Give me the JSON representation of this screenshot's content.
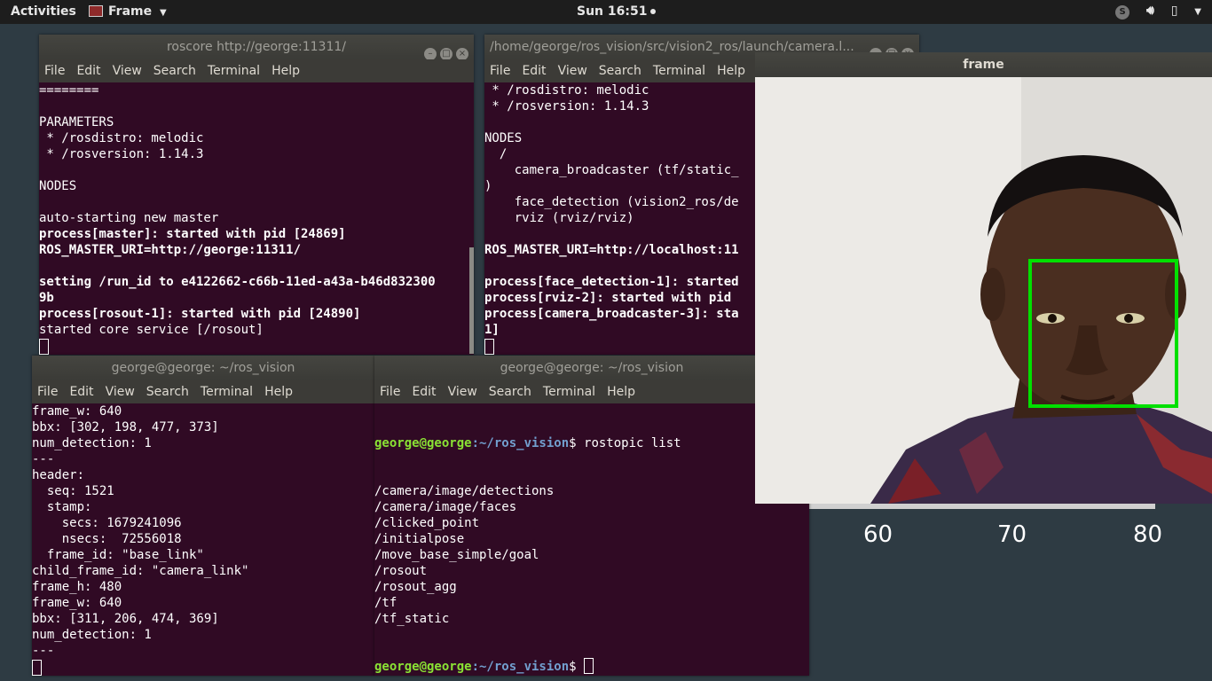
{
  "topbar": {
    "activities": "Activities",
    "app_name": "Frame",
    "clock": "Sun 16:51"
  },
  "desktop": {
    "axis_labels": [
      "60",
      "70",
      "80"
    ]
  },
  "menu": [
    "File",
    "Edit",
    "View",
    "Search",
    "Terminal",
    "Help"
  ],
  "win1": {
    "title": "roscore http://george:11311/",
    "lines": [
      {
        "t": "========",
        "b": false
      },
      {
        "t": "",
        "b": false
      },
      {
        "t": "PARAMETERS",
        "b": false
      },
      {
        "t": " * /rosdistro: melodic",
        "b": false
      },
      {
        "t": " * /rosversion: 1.14.3",
        "b": false
      },
      {
        "t": "",
        "b": false
      },
      {
        "t": "NODES",
        "b": false
      },
      {
        "t": "",
        "b": false
      },
      {
        "t": "auto-starting new master",
        "b": false
      },
      {
        "t": "process[master]: started with pid [24869]",
        "b": true
      },
      {
        "t": "ROS_MASTER_URI=http://george:11311/",
        "b": true
      },
      {
        "t": "",
        "b": false
      },
      {
        "t": "setting /run_id to e4122662-c66b-11ed-a43a-b46d832300",
        "b": true
      },
      {
        "t": "9b",
        "b": true
      },
      {
        "t": "process[rosout-1]: started with pid [24890]",
        "b": true
      },
      {
        "t": "started core service [/rosout]",
        "b": false
      }
    ]
  },
  "win2": {
    "title": "/home/george/ros_vision/src/vision2_ros/launch/camera.l...",
    "lines": [
      {
        "t": " * /rosdistro: melodic",
        "b": false
      },
      {
        "t": " * /rosversion: 1.14.3",
        "b": false
      },
      {
        "t": "",
        "b": false
      },
      {
        "t": "NODES",
        "b": false
      },
      {
        "t": "  /",
        "b": false
      },
      {
        "t": "    camera_broadcaster (tf/static_",
        "b": false
      },
      {
        "t": ")",
        "b": false
      },
      {
        "t": "    face_detection (vision2_ros/de",
        "b": false
      },
      {
        "t": "    rviz (rviz/rviz)",
        "b": false
      },
      {
        "t": "",
        "b": false
      },
      {
        "t": "ROS_MASTER_URI=http://localhost:11",
        "b": true
      },
      {
        "t": "",
        "b": false
      },
      {
        "t": "process[face_detection-1]: started",
        "b": true
      },
      {
        "t": "process[rviz-2]: started with pid",
        "b": true
      },
      {
        "t": "process[camera_broadcaster-3]: sta",
        "b": true
      },
      {
        "t": "1]",
        "b": true
      }
    ]
  },
  "win3": {
    "title": "george@george: ~/ros_vision",
    "lines": [
      "frame_w: 640",
      "bbx: [302, 198, 477, 373]",
      "num_detection: 1",
      "---",
      "header:",
      "  seq: 1521",
      "  stamp:",
      "    secs: 1679241096",
      "    nsecs:  72556018",
      "  frame_id: \"base_link\"",
      "child_frame_id: \"camera_link\"",
      "frame_h: 480",
      "frame_w: 640",
      "bbx: [311, 206, 474, 369]",
      "num_detection: 1",
      "---"
    ]
  },
  "win4": {
    "title": "george@george: ~/ros_vision",
    "prompt_user": "george@george",
    "prompt_path": ":~/ros_vision",
    "prompt_sign": "$ ",
    "command": "rostopic list",
    "topics": [
      "/camera/image/detections",
      "/camera/image/faces",
      "/clicked_point",
      "/initialpose",
      "/move_base_simple/goal",
      "/rosout",
      "/rosout_agg",
      "/tf",
      "/tf_static"
    ]
  },
  "frame_window": {
    "title": "frame"
  },
  "colors": {
    "terminal_bg": "#300a24",
    "prompt_green": "#8ae234",
    "prompt_blue": "#729fcf",
    "bbox_green": "#00e000"
  }
}
